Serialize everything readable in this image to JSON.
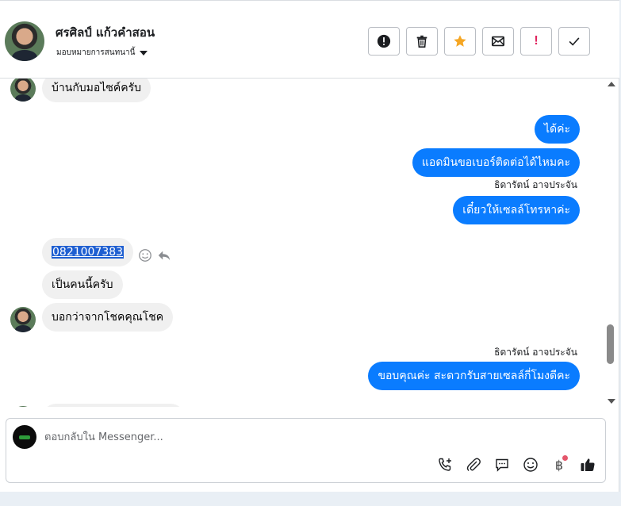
{
  "header": {
    "contact_name": "ศรศิลป์ แก้วคำสอน",
    "assign_label": "มอบหมายการสนทนานี้",
    "tools": [
      {
        "name": "spam-button",
        "icon": "exclamation-circle-icon"
      },
      {
        "name": "delete-button",
        "icon": "trash-icon"
      },
      {
        "name": "star-button",
        "icon": "star-icon"
      },
      {
        "name": "mark-unread-button",
        "icon": "envelope-icon"
      },
      {
        "name": "follow-up-button",
        "icon": "exclamation-icon",
        "label": "!"
      },
      {
        "name": "done-button",
        "icon": "check-icon"
      }
    ]
  },
  "messages": [
    {
      "direction": "in",
      "text": "บ้านกับมอไซค์ครับ"
    },
    {
      "direction": "out",
      "text": "ได้ค่ะ"
    },
    {
      "direction": "out",
      "text": "แอดมินขอเบอร์ติดต่อได้ไหมคะ"
    },
    {
      "direction": "out",
      "sender": "ธิดารัตน์ อาจประจัน",
      "text": "เดี๋ยวให้เซลล์โทรหาค่ะ"
    },
    {
      "direction": "in",
      "text": "0821007383",
      "selected": true
    },
    {
      "direction": "in",
      "text": "เป็นคนนี้ครับ"
    },
    {
      "direction": "in",
      "text": "บอกว่าจากโชคคุณโชค"
    },
    {
      "direction": "out",
      "sender": "ธิดารัตน์ อาจประจัน",
      "text": "ขอบคุณค่ะ สะดวกรับสายเซลล์กี่โมงดีคะ"
    }
  ],
  "composer": {
    "placeholder": "ตอบกลับใน Messenger...",
    "actions": [
      "phone-add-icon",
      "paperclip-icon",
      "chat-bubble-icon",
      "smiley-icon",
      "baht-icon",
      "thumbs-up-icon"
    ],
    "baht_symbol": "฿"
  },
  "colors": {
    "outgoing_bubble": "#0a7cff",
    "incoming_bubble": "#f0f0f0",
    "star": "#f5a623",
    "alert": "#e0245e"
  }
}
